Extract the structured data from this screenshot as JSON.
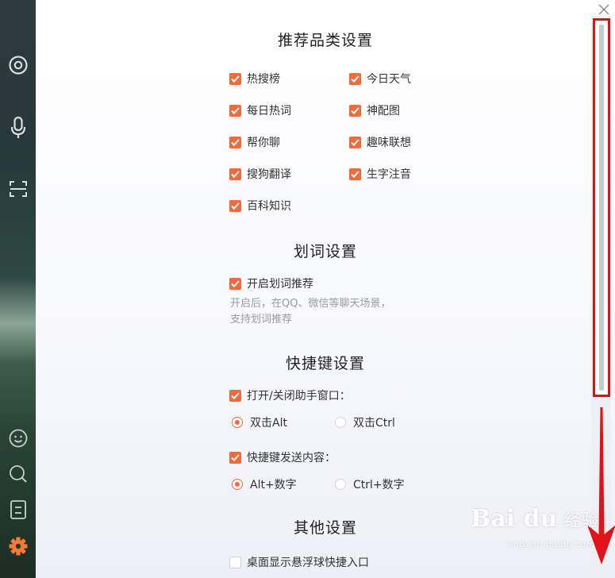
{
  "close_label": "×",
  "sections": {
    "category": "推荐品类设置",
    "selection": "划词设置",
    "shortcut": "快捷键设置",
    "other": "其他设置"
  },
  "categories": [
    "热搜榜",
    "今日天气",
    "每日热词",
    "神配图",
    "帮你聊",
    "趣味联想",
    "搜狗翻译",
    "生字注音",
    "百科知识"
  ],
  "selection": {
    "enable_label": "开启划词推荐",
    "hint_line1": "开启后，在QQ、微信等聊天场景，",
    "hint_line2": "支持划词推荐"
  },
  "shortcut": {
    "toggle_label": "打开/关闭助手窗口：",
    "toggle_options": [
      "双击Alt",
      "双击Ctrl"
    ],
    "send_label": "快捷键发送内容：",
    "send_options": [
      "Alt+数字",
      "Ctrl+数字"
    ]
  },
  "other": {
    "float_label": "桌面显示悬浮球快捷入口"
  },
  "watermark": {
    "brand": "Bai du",
    "jingyan": "经验",
    "url": "jingyan.baidu.com"
  },
  "colors": {
    "accent": "#f16a3c",
    "highlight": "#d8141a"
  }
}
